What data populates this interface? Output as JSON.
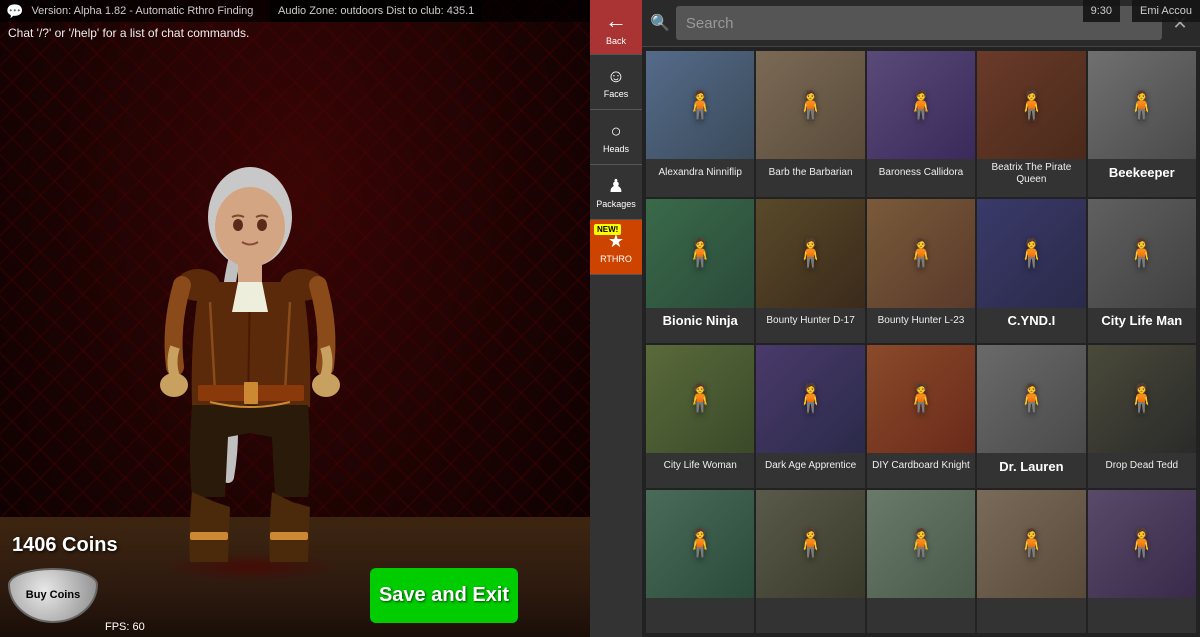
{
  "topbar": {
    "version": "Version: Alpha 1.82 - Automatic Rthro Finding",
    "audio_zone": "Audio Zone: outdoors Dist to club: 435.1",
    "account_label": "Emi Accou"
  },
  "chat": {
    "hint": "Chat '/?' or '/help' for a list of chat commands."
  },
  "player": {
    "coins": "1406 Coins",
    "fps": "FPS: 60"
  },
  "buttons": {
    "back": "←",
    "save_exit": "Save and Exit",
    "buy_coins": "Buy Coins",
    "search_close": "✕"
  },
  "nav": {
    "items": [
      {
        "label": "Back",
        "icon": "←"
      },
      {
        "label": "Faces",
        "icon": "☺"
      },
      {
        "label": "Heads",
        "icon": "○"
      },
      {
        "label": "Packages",
        "icon": "♟"
      },
      {
        "label": "RTHRO",
        "icon": "★",
        "badge": "NEW!"
      }
    ]
  },
  "search": {
    "placeholder": "Search"
  },
  "items": [
    {
      "name": "Alexandra Ninniflip",
      "highlighted": false,
      "row": "row1-1"
    },
    {
      "name": "Barb the Barbarian",
      "highlighted": false,
      "row": "row1-2"
    },
    {
      "name": "Baroness Callidora",
      "highlighted": false,
      "row": "row1-3"
    },
    {
      "name": "Beatrix The Pirate Queen",
      "highlighted": false,
      "row": "row1-4"
    },
    {
      "name": "Beekeeper",
      "highlighted": true,
      "row": "row1-5"
    },
    {
      "name": "Bionic Ninja",
      "highlighted": true,
      "row": "row2-1"
    },
    {
      "name": "Bounty Hunter D-17",
      "highlighted": false,
      "row": "row2-2"
    },
    {
      "name": "Bounty Hunter L-23",
      "highlighted": false,
      "row": "row2-3"
    },
    {
      "name": "C.YND.I",
      "highlighted": true,
      "row": "row2-4"
    },
    {
      "name": "City Life Man",
      "highlighted": true,
      "row": "row2-5"
    },
    {
      "name": "City Life Woman",
      "highlighted": false,
      "row": "row3-1"
    },
    {
      "name": "Dark Age Apprentice",
      "highlighted": false,
      "row": "row3-2"
    },
    {
      "name": "DIY Cardboard Knight",
      "highlighted": false,
      "row": "row3-3"
    },
    {
      "name": "Dr. Lauren",
      "highlighted": true,
      "row": "row3-4"
    },
    {
      "name": "Drop Dead Tedd",
      "highlighted": false,
      "row": "row3-5"
    },
    {
      "name": "",
      "highlighted": false,
      "row": "row4-1"
    },
    {
      "name": "",
      "highlighted": false,
      "row": "row4-2"
    },
    {
      "name": "",
      "highlighted": false,
      "row": "row4-3"
    },
    {
      "name": "",
      "highlighted": false,
      "row": "row4-4"
    },
    {
      "name": "",
      "highlighted": false,
      "row": "row4-5"
    }
  ],
  "colors": {
    "back_btn": "#aa3333",
    "rthro_btn": "#cc4400",
    "save_btn": "#00cc00",
    "panel_bg": "#1a1a1a",
    "nav_bg": "#333333"
  }
}
